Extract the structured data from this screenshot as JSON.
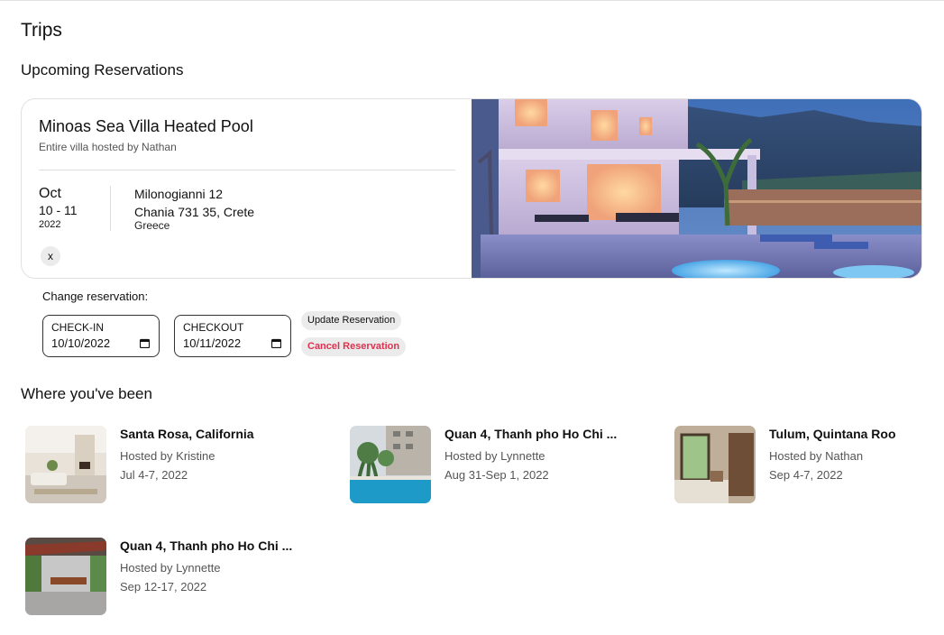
{
  "page": {
    "title": "Trips"
  },
  "upcoming": {
    "section_title": "Upcoming Reservations",
    "reservation": {
      "name": "Minoas Sea Villa Heated Pool",
      "subtitle": "Entire villa hosted by Nathan",
      "month": "Oct",
      "days": "10 - 11",
      "year": "2022",
      "address_line1": "Milonogianni 12",
      "address_line2": "Chania 731 35, Crete",
      "address_line3": "Greece",
      "close_label": "x"
    }
  },
  "change": {
    "label": "Change reservation:",
    "checkin_label": "CHECK-IN",
    "checkin_value": "10/10/2022",
    "checkout_label": "CHECKOUT",
    "checkout_value": "10/11/2022",
    "update_label": "Update Reservation",
    "cancel_label": "Cancel Reservation",
    "cancel_color": "#e0314f"
  },
  "past": {
    "section_title": "Where you've been",
    "trips": [
      {
        "name": "Santa Rosa, California",
        "host": "Hosted by Kristine",
        "dates": "Jul 4-7, 2022"
      },
      {
        "name": "Quan 4, Thanh pho Ho Chi ...",
        "host": "Hosted by Lynnette",
        "dates": "Aug 31-Sep 1, 2022"
      },
      {
        "name": "Tulum, Quintana Roo",
        "host": "Hosted by Nathan",
        "dates": "Sep 4-7, 2022"
      },
      {
        "name": "Quan 4, Thanh pho Ho Chi ...",
        "host": "Hosted by Lynnette",
        "dates": "Sep 12-17, 2022"
      }
    ]
  }
}
